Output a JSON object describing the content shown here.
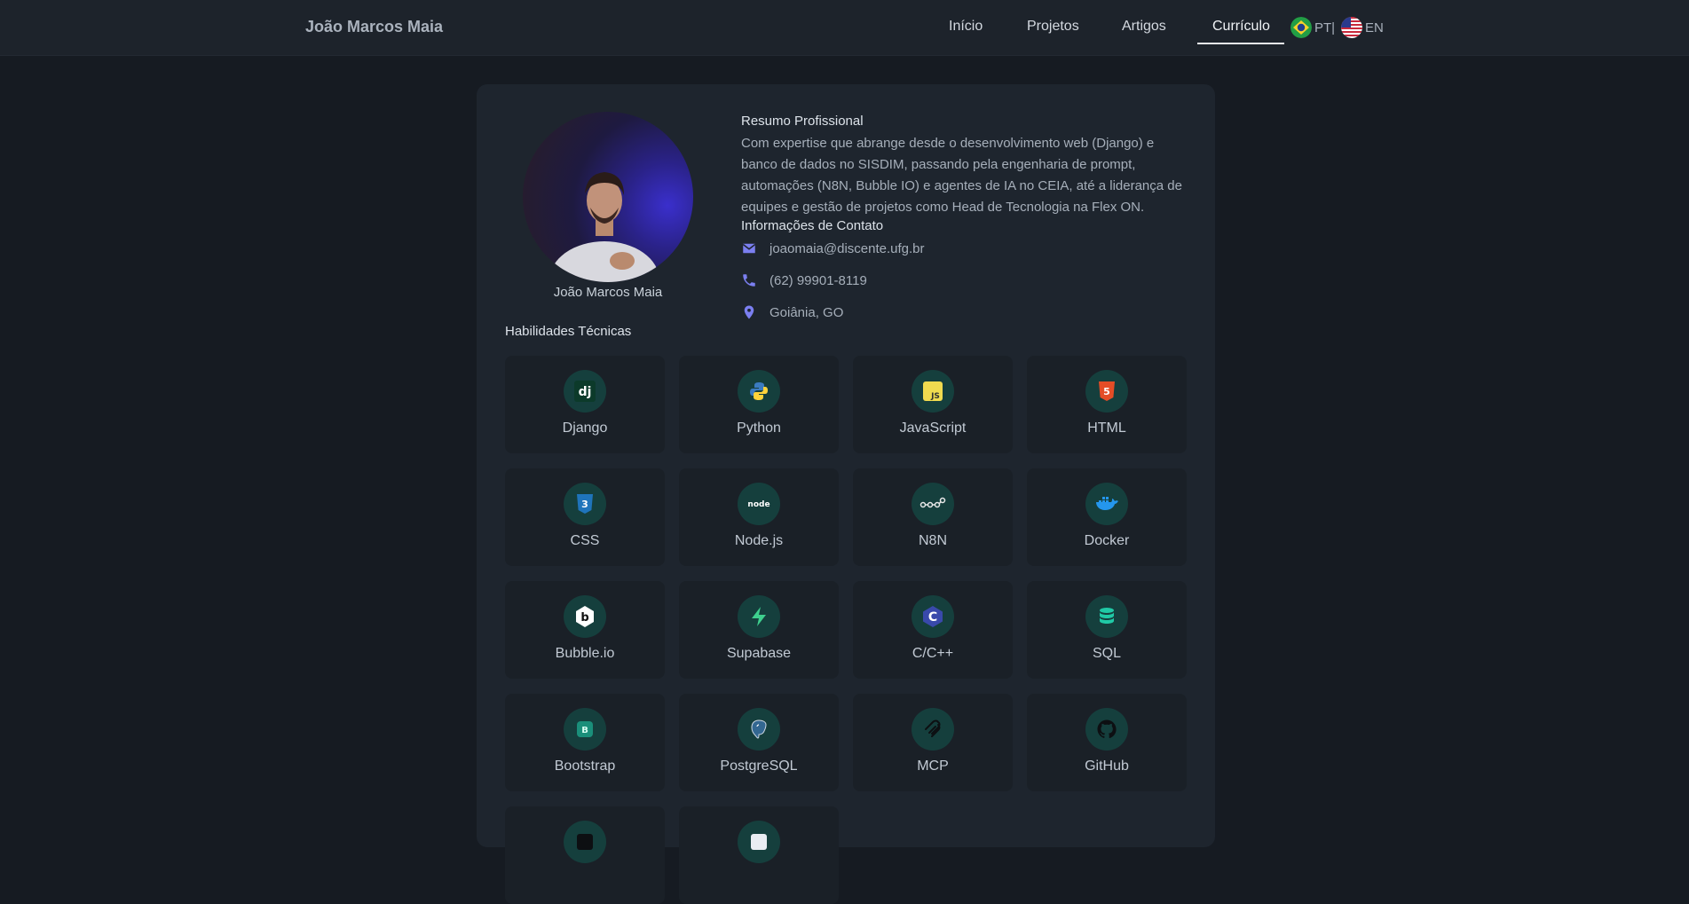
{
  "nav": {
    "brand": "João Marcos Maia",
    "links": [
      {
        "label": "Início"
      },
      {
        "label": "Projetos"
      },
      {
        "label": "Artigos"
      },
      {
        "label": "Currículo",
        "active": true
      }
    ],
    "languages": [
      {
        "code": "PT|",
        "flag": "brazil-flag-icon"
      },
      {
        "code": "EN",
        "flag": "usa-flag-icon"
      }
    ]
  },
  "profile": {
    "name": "João Marcos Maia"
  },
  "summary": {
    "title": "Resumo Profissional",
    "text": "Com expertise que abrange desde o desenvolvimento web (Django) e banco de dados no SISDIM, passando pela engenharia de prompt, automações (N8N, Bubble IO) e agentes de IA no CEIA, até a liderança de equipes e gestão de projetos como Head de Tecnologia na Flex ON."
  },
  "contact": {
    "title": "Informações de Contato",
    "email": "joaomaia@discente.ufg.br",
    "phone": "(62) 99901-8119",
    "location": "Goiânia, GO"
  },
  "skills": {
    "title": "Habilidades Técnicas",
    "items": [
      {
        "label": "Django",
        "icon": "django-icon"
      },
      {
        "label": "Python",
        "icon": "python-icon"
      },
      {
        "label": "JavaScript",
        "icon": "javascript-icon"
      },
      {
        "label": "HTML",
        "icon": "html5-icon"
      },
      {
        "label": "CSS",
        "icon": "css3-icon"
      },
      {
        "label": "Node.js",
        "icon": "nodejs-icon"
      },
      {
        "label": "N8N",
        "icon": "n8n-icon"
      },
      {
        "label": "Docker",
        "icon": "docker-icon"
      },
      {
        "label": "Bubble.io",
        "icon": "bubble-icon"
      },
      {
        "label": "Supabase",
        "icon": "supabase-icon"
      },
      {
        "label": "C/C++",
        "icon": "cpp-icon"
      },
      {
        "label": "SQL",
        "icon": "database-icon"
      },
      {
        "label": "Bootstrap",
        "icon": "bootstrap-icon"
      },
      {
        "label": "PostgreSQL",
        "icon": "postgresql-icon"
      },
      {
        "label": "MCP",
        "icon": "mcp-icon"
      },
      {
        "label": "GitHub",
        "icon": "github-icon"
      }
    ]
  },
  "colors": {
    "accent": "#7b7ff0",
    "icon_bg": "#153f3d",
    "card_bg": "#1e252e",
    "page_bg": "#161b22"
  }
}
